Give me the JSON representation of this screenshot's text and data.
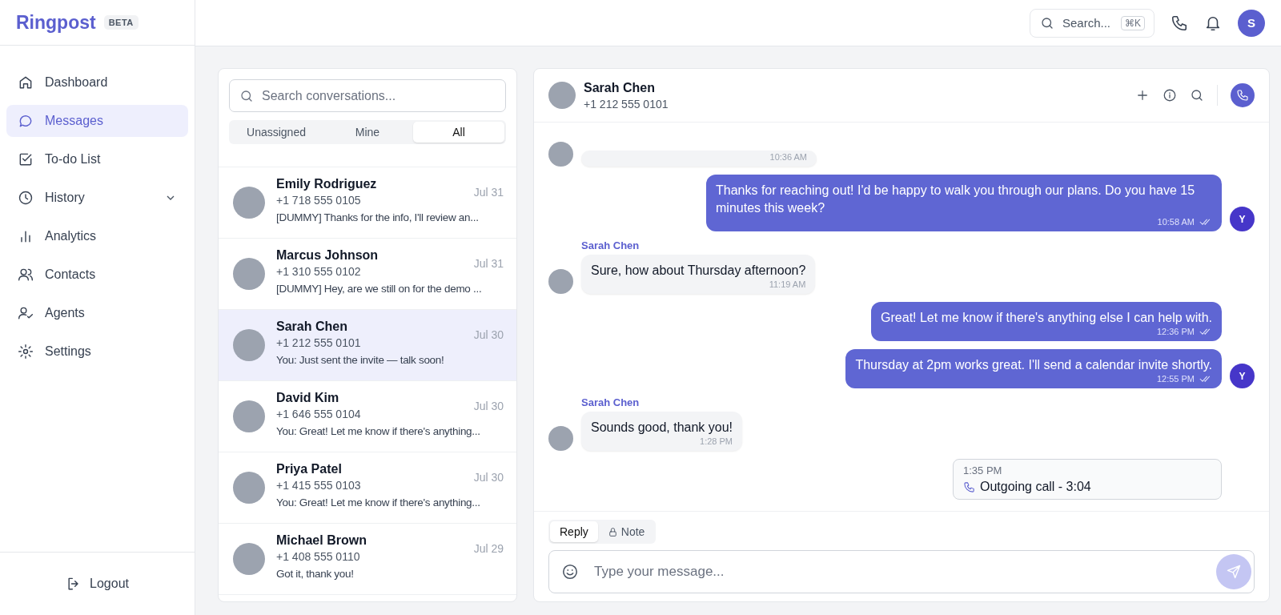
{
  "brand": {
    "name": "Ringpost",
    "badge": "BETA"
  },
  "sidebar": {
    "items": [
      {
        "label": "Dashboard",
        "selected": false,
        "expandable": false
      },
      {
        "label": "Messages",
        "selected": true,
        "expandable": false
      },
      {
        "label": "To-do List",
        "selected": false,
        "expandable": false
      },
      {
        "label": "History",
        "selected": false,
        "expandable": true
      },
      {
        "label": "Analytics",
        "selected": false,
        "expandable": false
      },
      {
        "label": "Contacts",
        "selected": false,
        "expandable": false
      },
      {
        "label": "Agents",
        "selected": false,
        "expandable": false
      },
      {
        "label": "Settings",
        "selected": false,
        "expandable": false
      }
    ],
    "logout": "Logout"
  },
  "topbar": {
    "search": {
      "placeholder": "Search...",
      "shortcut": "⌘K"
    },
    "user_initial": "S"
  },
  "conversations": {
    "search": {
      "placeholder": "Search conversations..."
    },
    "tabs": [
      {
        "label": "Unassigned",
        "selected": false
      },
      {
        "label": "Mine",
        "selected": false
      },
      {
        "label": "All",
        "selected": true
      }
    ],
    "items": [
      {
        "name": "Emily Rodriguez",
        "phone": "+1 718 555 0105",
        "date": "Jul 31",
        "preview": "[DUMMY] Thanks for the info, I'll review an...",
        "selected": false
      },
      {
        "name": "Marcus Johnson",
        "phone": "+1 310 555 0102",
        "date": "Jul 31",
        "preview": "[DUMMY] Hey, are we still on for the demo ...",
        "selected": false
      },
      {
        "name": "Sarah Chen",
        "phone": "+1 212 555 0101",
        "date": "Jul 30",
        "preview": "You: Just sent the invite — talk soon!",
        "selected": true
      },
      {
        "name": "David Kim",
        "phone": "+1 646 555 0104",
        "date": "Jul 30",
        "preview": "You: Great! Let me know if there's anything...",
        "selected": false
      },
      {
        "name": "Priya Patel",
        "phone": "+1 415 555 0103",
        "date": "Jul 30",
        "preview": "You: Great! Let me know if there's anything...",
        "selected": false
      },
      {
        "name": "Michael Brown",
        "phone": "+1 408 555 0110",
        "date": "Jul 29",
        "preview": "Got it, thank you!",
        "selected": false
      }
    ]
  },
  "chat": {
    "contact": {
      "name": "Sarah Chen",
      "phone": "+1 212 555 0101"
    },
    "messages": [
      {
        "kind": "incoming",
        "time": "10:36 AM"
      },
      {
        "kind": "outgoing",
        "text": "Thanks for reaching out! I'd be happy to walk you through our plans. Do you have 15 minutes this week?",
        "time": "10:58 AM",
        "read": true,
        "avatar": "Y"
      },
      {
        "kind": "incoming",
        "sender": "Sarah Chen",
        "text": "Sure, how about Thursday afternoon?",
        "time": "11:19 AM"
      },
      {
        "kind": "outgoing",
        "text": "Great! Let me know if there's anything else I can help with.",
        "time": "12:36 PM",
        "read": true
      },
      {
        "kind": "outgoing",
        "text": "Thursday at 2pm works great. I'll send a calendar invite shortly.",
        "time": "12:55 PM",
        "read": true,
        "avatar": "Y"
      },
      {
        "kind": "incoming",
        "sender": "Sarah Chen",
        "text": "Sounds good, thank you!",
        "time": "1:28 PM"
      },
      {
        "kind": "call",
        "time": "1:35 PM",
        "text": "Outgoing call - 3:04"
      }
    ],
    "composer": {
      "tabs": [
        {
          "label": "Reply",
          "selected": true
        },
        {
          "label": "Note",
          "selected": false
        }
      ],
      "placeholder": "Type your message..."
    }
  }
}
